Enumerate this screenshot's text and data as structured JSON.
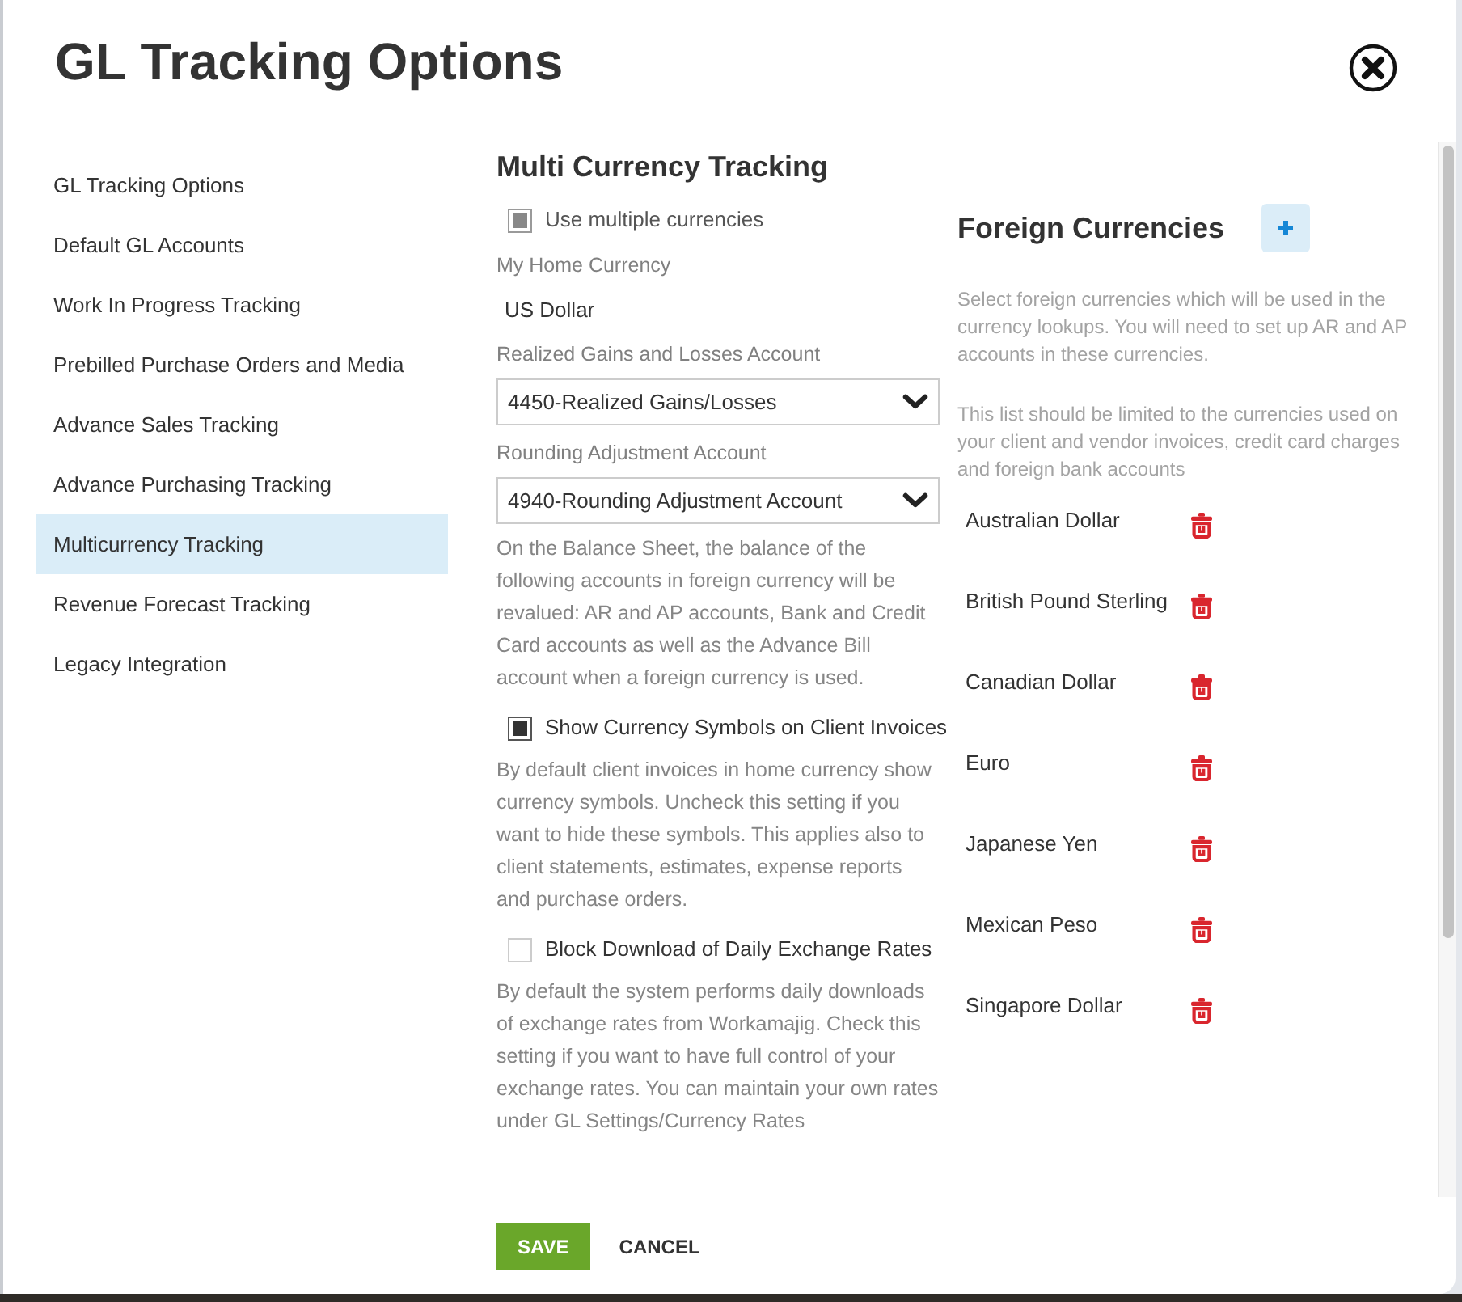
{
  "dialog": {
    "title": "GL Tracking Options"
  },
  "sidebar": {
    "items": [
      {
        "label": "GL Tracking Options",
        "selected": false
      },
      {
        "label": "Default GL Accounts",
        "selected": false
      },
      {
        "label": "Work In Progress Tracking",
        "selected": false
      },
      {
        "label": "Prebilled Purchase Orders and Media",
        "selected": false
      },
      {
        "label": "Advance Sales Tracking",
        "selected": false
      },
      {
        "label": "Advance Purchasing Tracking",
        "selected": false
      },
      {
        "label": "Multicurrency Tracking",
        "selected": true
      },
      {
        "label": "Revenue Forecast Tracking",
        "selected": false
      },
      {
        "label": "Legacy Integration",
        "selected": false
      }
    ]
  },
  "multi_currency": {
    "title": "Multi Currency Tracking",
    "fields": [
      {
        "kind": "checkbox",
        "label": "Use multiple currencies",
        "checked": true,
        "disabled": true
      },
      {
        "kind": "label",
        "text": "My Home Currency"
      },
      {
        "kind": "value",
        "text": "US Dollar"
      },
      {
        "kind": "label",
        "text": "Realized Gains and Losses Account"
      },
      {
        "kind": "select",
        "value": "4450-Realized Gains/Losses"
      },
      {
        "kind": "label",
        "text": "Rounding Adjustment Account"
      },
      {
        "kind": "select",
        "value": "4940-Rounding Adjustment Account"
      },
      {
        "kind": "note",
        "text": "On the Balance Sheet, the balance of the following accounts in foreign currency will be revalued: AR and AP accounts, Bank and Credit Card accounts as well as the Advance Bill account when a foreign currency is used."
      },
      {
        "kind": "checkbox",
        "label": "Show Currency Symbols on Client Invoices",
        "checked": true,
        "disabled": false
      },
      {
        "kind": "note",
        "text": "By default client invoices in home currency show currency symbols. Uncheck this setting if you want to hide these symbols. This applies also to client statements, estimates, expense reports and purchase orders."
      },
      {
        "kind": "checkbox",
        "label": "Block Download of Daily Exchange Rates",
        "checked": false,
        "disabled": false
      },
      {
        "kind": "note",
        "text": "By default the system performs daily downloads of exchange rates from Workamajig. Check this setting if you want to have full control of your exchange rates. You can maintain your own rates under GL Settings/Currency Rates"
      }
    ]
  },
  "foreign_currencies": {
    "title": "Foreign Currencies",
    "notes": [
      "Select foreign currencies which will be used in the currency lookups. You will need to set up AR and AP accounts in these currencies.",
      "This list should be limited to the currencies used on your client and vendor invoices, credit card charges and foreign bank accounts"
    ],
    "currencies": [
      {
        "name": "Australian Dollar"
      },
      {
        "name": "British Pound Sterling"
      },
      {
        "name": "Canadian Dollar"
      },
      {
        "name": "Euro"
      },
      {
        "name": "Japanese Yen"
      },
      {
        "name": "Mexican Peso"
      },
      {
        "name": "Singapore Dollar"
      }
    ]
  },
  "buttons": [
    {
      "label": "SAVE",
      "kind": "primary"
    },
    {
      "label": "CANCEL",
      "kind": "link"
    }
  ]
}
